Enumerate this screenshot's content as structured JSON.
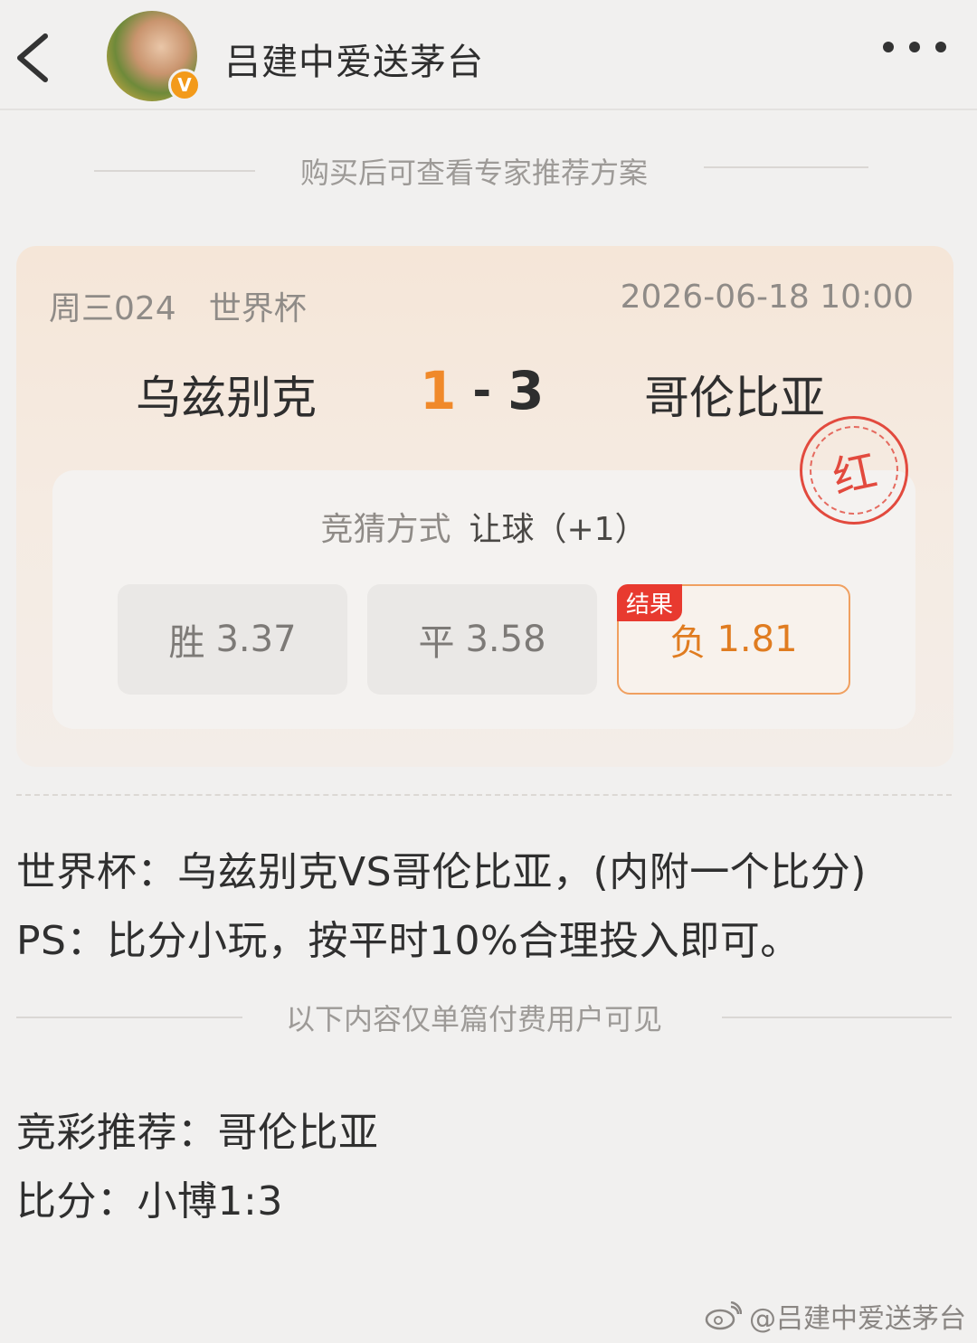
{
  "header": {
    "title": "吕建中爱送茅台",
    "badge": "V"
  },
  "purchase_divider": "购买后可查看专家推荐方案",
  "match": {
    "league_code": "周三024",
    "league_name": "世界杯",
    "datetime": "2026-06-18 10:00",
    "home_team": "乌兹别克",
    "away_team": "哥伦比亚",
    "score_home": "1",
    "score_sep": "-",
    "score_away": "3",
    "stamp_text": "红",
    "bet_method_label": "竞猜方式",
    "bet_method_value": "让球（+1）",
    "options": [
      {
        "label": "胜",
        "odds": "3.37"
      },
      {
        "label": "平",
        "odds": "3.58"
      },
      {
        "label": "负",
        "odds": "1.81"
      }
    ],
    "result_tag": "结果"
  },
  "content": {
    "line1": "世界杯：乌兹别克VS哥伦比亚，(内附一个比分)",
    "line2": "PS：比分小玩，按平时10%合理投入即可。"
  },
  "paid_divider": "以下内容仅单篇付费用户可见",
  "recommendation": {
    "line1": "竞彩推荐：哥伦比亚",
    "line2": "比分：小博1:3"
  },
  "watermark": "@吕建中爱送茅台",
  "colors": {
    "accent": "#f0892a",
    "stamp": "#e24a3e",
    "result_tag": "#e83a2f"
  }
}
